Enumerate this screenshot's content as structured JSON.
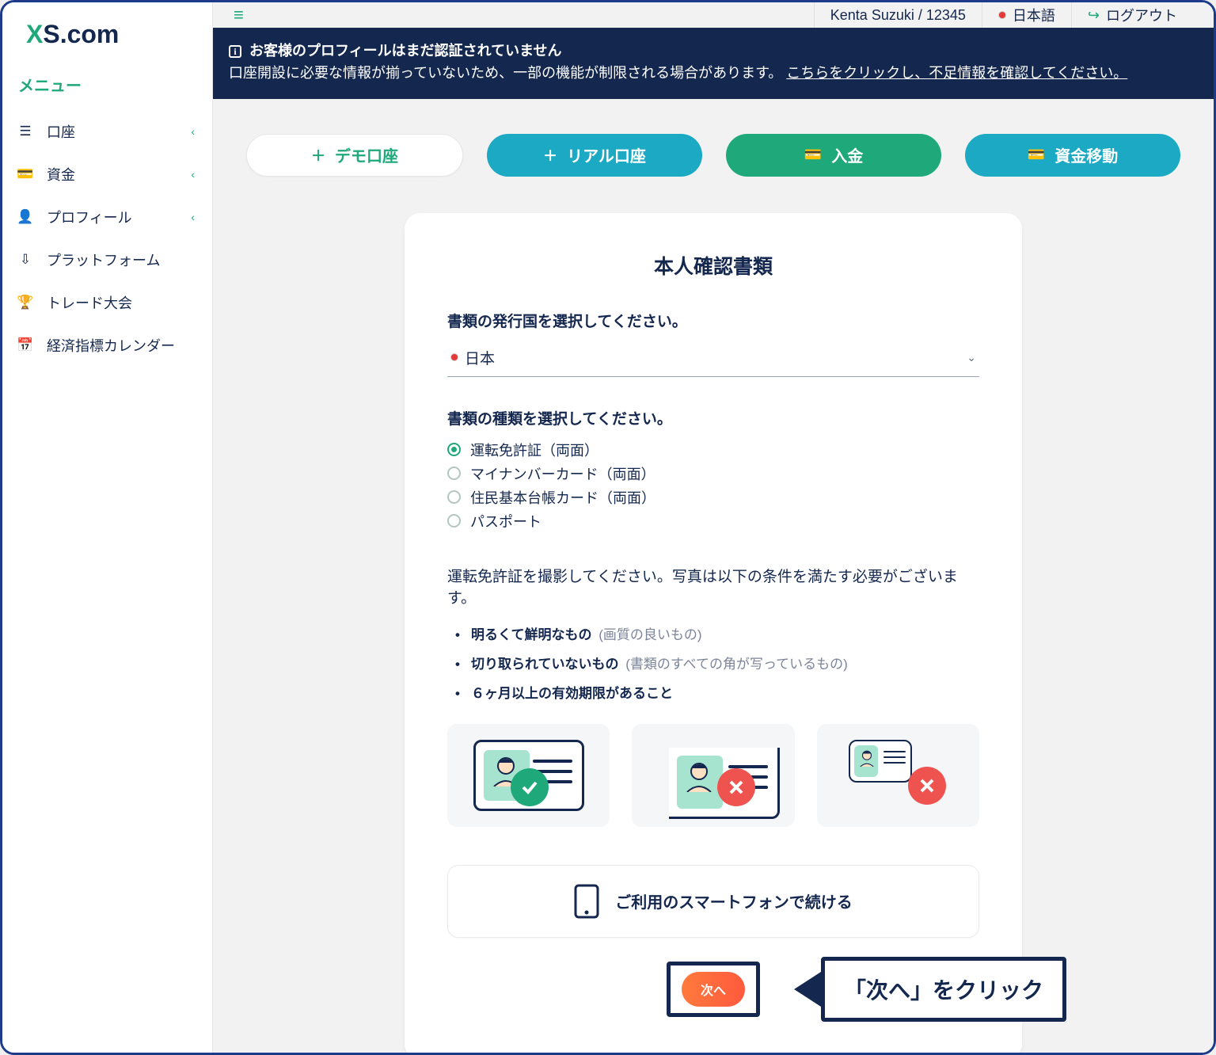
{
  "logo": {
    "part1": "X",
    "part2": "S",
    "dot": ".",
    "part3": "com"
  },
  "sidebar": {
    "title": "メニュー",
    "items": [
      {
        "icon": "list",
        "label": "口座",
        "chev": true
      },
      {
        "icon": "wallet",
        "label": "資金",
        "chev": true
      },
      {
        "icon": "user",
        "label": "プロフィール",
        "chev": true
      },
      {
        "icon": "download",
        "label": "プラットフォーム",
        "chev": false
      },
      {
        "icon": "trophy",
        "label": "トレード大会",
        "chev": false
      },
      {
        "icon": "calendar",
        "label": "経済指標カレンダー",
        "chev": false
      }
    ]
  },
  "topbar": {
    "user": "Kenta Suzuki / 12345",
    "lang": "日本語",
    "logout": "ログアウト"
  },
  "alert": {
    "head": "お客様のプロフィールはまだ認証されていません",
    "body": "口座開設に必要な情報が揃っていないため、一部の機能が制限される場合があります。 ",
    "link": "こちらをクリックし、不足情報を確認してください。"
  },
  "actions": {
    "demo": "デモ口座",
    "real": "リアル口座",
    "deposit": "入金",
    "transfer": "資金移動"
  },
  "card": {
    "title": "本人確認書類",
    "issuer_label": "書類の発行国を選択してください。",
    "issuer_value": "日本",
    "type_label": "書類の種類を選択してください。",
    "types": [
      "運転免許証（両面）",
      "マイナンバーカード（両面）",
      "住民基本台帳カード（両面）",
      "パスポート"
    ],
    "type_selected": 0,
    "instruction": "運転免許証を撮影してください。写真は以下の条件を満たす必要がございます。",
    "conditions": [
      {
        "bold": "明るくて鮮明なもの",
        "note": "(画質の良いもの)"
      },
      {
        "bold": "切り取られていないもの",
        "note": "(書類のすべての角が写っているもの)"
      },
      {
        "bold": "６ヶ月以上の有効期限があること",
        "note": ""
      }
    ],
    "phone_button": "ご利用のスマートフォンで続ける",
    "next": "次へ"
  },
  "callout": "「次へ」をクリック"
}
